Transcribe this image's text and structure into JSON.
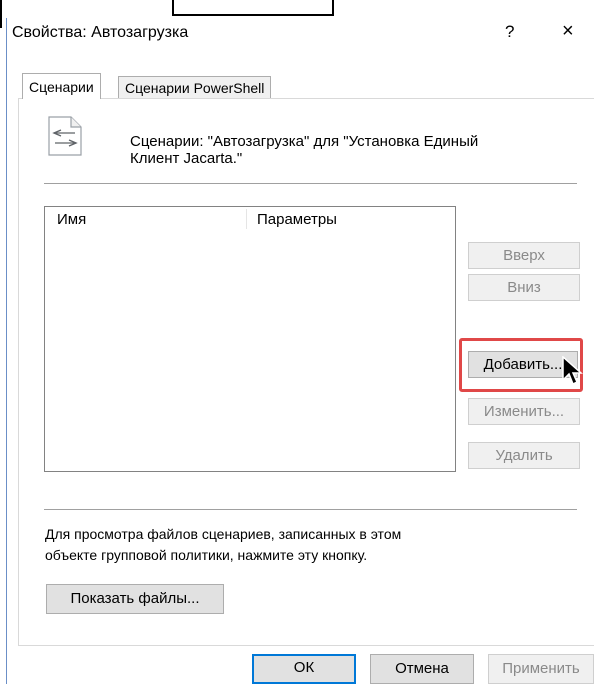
{
  "window": {
    "title": "Свойства: Автозагрузка",
    "help_label": "?",
    "close_label": "×"
  },
  "tabs": [
    {
      "label": "Сценарии"
    },
    {
      "label": "Сценарии PowerShell"
    }
  ],
  "header_text_line1": "Сценарии: \"Автозагрузка\" для \"Установка Единый",
  "header_text_line2": "Клиент Jacarta.\"",
  "table": {
    "columns": [
      "Имя",
      "Параметры"
    ],
    "rows": []
  },
  "buttons": {
    "up": "Вверх",
    "down": "Вниз",
    "add": "Добавить...",
    "edit": "Изменить...",
    "remove": "Удалить",
    "show_files": "Показать файлы...",
    "ok": "ОК",
    "cancel": "Отмена",
    "apply": "Применить"
  },
  "info_line1": "Для просмотра файлов сценариев, записанных в этом",
  "info_line2": "объекте групповой политики, нажмите эту кнопку.",
  "icons": {
    "script": "script-file-icon",
    "close": "close-icon",
    "cursor": "mouse-cursor-icon"
  },
  "colors": {
    "highlight": "#e04848",
    "focus": "#0078d7"
  }
}
